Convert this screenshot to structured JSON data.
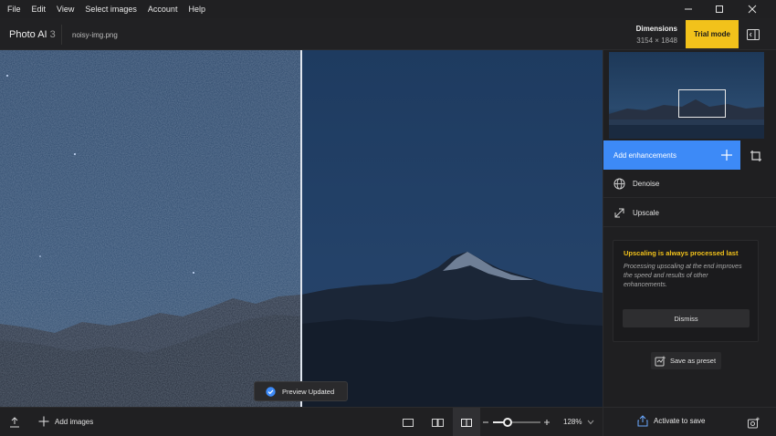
{
  "menu": [
    "File",
    "Edit",
    "View",
    "Select images",
    "Account",
    "Help"
  ],
  "window_controls": [
    "minimize-icon",
    "maximize-icon",
    "close-icon"
  ],
  "app": {
    "name": "Photo AI",
    "version": "3"
  },
  "file": {
    "name": "noisy-img.png"
  },
  "dimensions": {
    "label": "Dimensions",
    "value": "3154 × 1848"
  },
  "header": {
    "trial_label": "Trial mode"
  },
  "sidebar": {
    "add_enhancements_label": "Add enhancements",
    "enhancements": [
      {
        "label": "Denoise",
        "icon": "globe-icon"
      },
      {
        "label": "Upscale",
        "icon": "expand-arrows-icon"
      }
    ],
    "notice": {
      "title": "Upscaling is always processed last",
      "body": "Processing upscaling at the end improves the speed and results of other enhancements.",
      "dismiss_label": "Dismiss"
    },
    "save_preset_label": "Save as preset"
  },
  "toast": {
    "label": "Preview Updated"
  },
  "bottombar": {
    "add_images_label": "Add images",
    "zoom_value": "128%",
    "zoom_level": 0.3,
    "activate_label": "Activate to save"
  },
  "colors": {
    "accent": "#3d8af7",
    "trial": "#f2c21b",
    "notice_title": "#f2c21b",
    "background": "#1c1c1e"
  }
}
